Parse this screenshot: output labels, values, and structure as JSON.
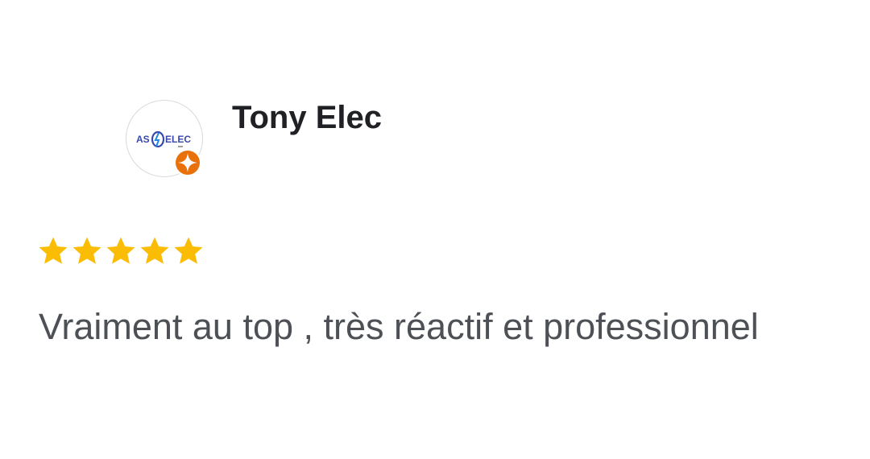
{
  "review": {
    "author_name": "Tony Elec",
    "avatar_label": "AS ELEC",
    "rating": 5,
    "rating_max": 5,
    "text": "Vraiment au top , très réactif et professionnel"
  },
  "colors": {
    "star": "#fbbc04",
    "badge": "#e8710a",
    "name": "#202124",
    "text": "#4d5156",
    "logo_blue": "#3949ab"
  },
  "icons": {
    "badge": "local-guide-badge-icon",
    "star": "star-icon"
  }
}
